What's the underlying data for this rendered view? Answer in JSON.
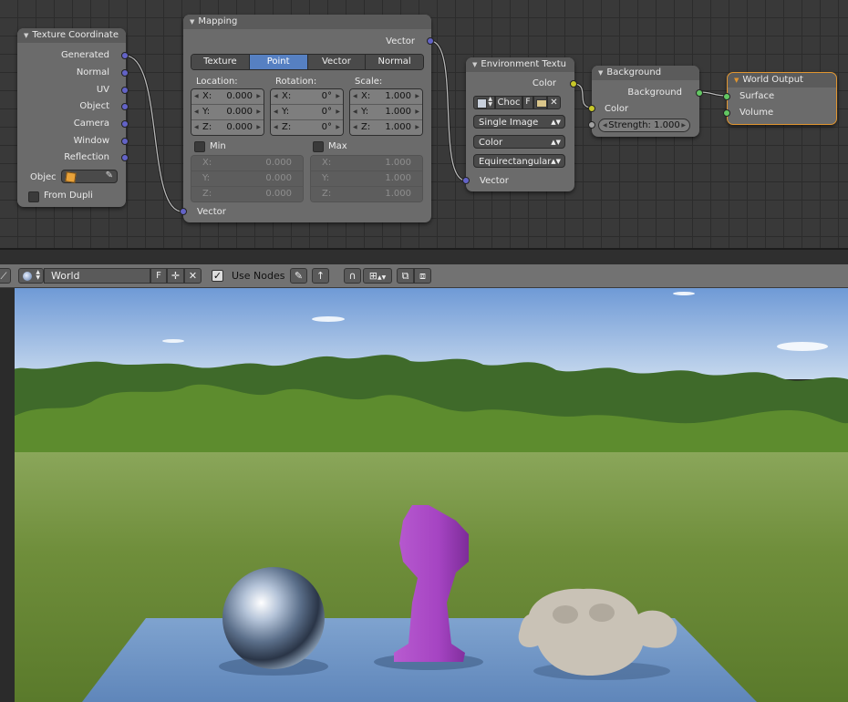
{
  "colors": {
    "socket_vector": "#6363c7",
    "socket_color": "#c7c729",
    "socket_float": "#a1a1a1",
    "socket_shader": "#63c763",
    "active_tab": "#5680c2",
    "output_border": "#e09530"
  },
  "nodes": {
    "texcoord": {
      "title": "Texture Coordinate",
      "outputs": [
        "Generated",
        "Normal",
        "UV",
        "Object",
        "Camera",
        "Window",
        "Reflection"
      ],
      "object_label": "Objec",
      "from_dupli": "From Dupli"
    },
    "mapping": {
      "title": "Mapping",
      "output": "Vector",
      "tabs": [
        "Texture",
        "Point",
        "Vector",
        "Normal"
      ],
      "active_tab": "Point",
      "location_label": "Location:",
      "rotation_label": "Rotation:",
      "scale_label": "Scale:",
      "location": [
        {
          "axis": "X:",
          "value": "0.000"
        },
        {
          "axis": "Y:",
          "value": "0.000"
        },
        {
          "axis": "Z:",
          "value": "0.000"
        }
      ],
      "rotation": [
        {
          "axis": "X:",
          "value": "0°"
        },
        {
          "axis": "Y:",
          "value": "0°"
        },
        {
          "axis": "Z:",
          "value": "0°"
        }
      ],
      "scale": [
        {
          "axis": "X:",
          "value": "1.000"
        },
        {
          "axis": "Y:",
          "value": "1.000"
        },
        {
          "axis": "Z:",
          "value": "1.000"
        }
      ],
      "min_label": "Min",
      "max_label": "Max",
      "min": [
        {
          "axis": "X:",
          "value": "0.000"
        },
        {
          "axis": "Y:",
          "value": "0.000"
        },
        {
          "axis": "Z:",
          "value": "0.000"
        }
      ],
      "max": [
        {
          "axis": "X:",
          "value": "1.000"
        },
        {
          "axis": "Y:",
          "value": "1.000"
        },
        {
          "axis": "Z:",
          "value": "1.000"
        }
      ],
      "input": "Vector"
    },
    "envtex": {
      "title": "Environment Textu",
      "output": "Color",
      "image_name": "Choc",
      "fake_user": "F",
      "source": "Single Image",
      "color_space": "Color",
      "projection": "Equirectangular",
      "input": "Vector"
    },
    "background": {
      "title": "Background",
      "output": "Background",
      "color_label": "Color",
      "strength": "Strength: 1.000"
    },
    "output": {
      "title": "World Output",
      "inputs": [
        "Surface",
        "Volume"
      ]
    }
  },
  "header": {
    "world_name": "World",
    "fake_user": "F",
    "use_nodes_label": "Use Nodes",
    "use_nodes": true
  }
}
